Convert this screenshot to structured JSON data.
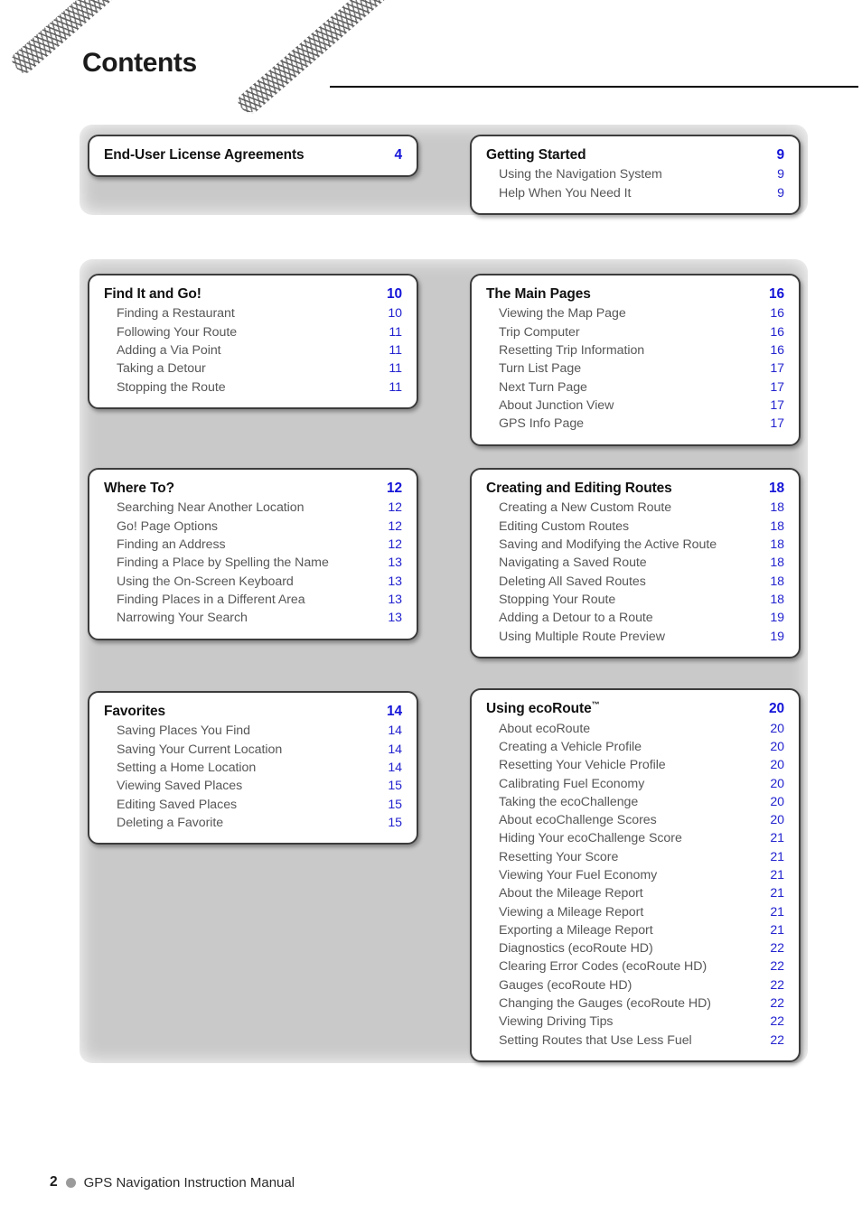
{
  "header": {
    "title": "Contents",
    "decor_icon": "braided-cable"
  },
  "sections": [
    {
      "id": "eula",
      "column": "left",
      "title": "End-User License Agreements",
      "page": "4",
      "items": []
    },
    {
      "id": "getting-started",
      "column": "right",
      "title": "Getting Started",
      "page": "9",
      "items": [
        {
          "title": "Using the Navigation System",
          "page": "9"
        },
        {
          "title": "Help When You Need It",
          "page": "9"
        }
      ]
    },
    {
      "id": "find-it-and-go",
      "column": "left",
      "title": "Find It and Go!",
      "page": "10",
      "items": [
        {
          "title": "Finding a Restaurant",
          "page": "10"
        },
        {
          "title": "Following Your Route",
          "page": "11"
        },
        {
          "title": "Adding a Via Point",
          "page": "11"
        },
        {
          "title": "Taking a Detour",
          "page": "11"
        },
        {
          "title": "Stopping the Route",
          "page": "11"
        }
      ]
    },
    {
      "id": "the-main-pages",
      "column": "right",
      "title": "The Main Pages",
      "page": "16",
      "items": [
        {
          "title": "Viewing the Map Page",
          "page": "16"
        },
        {
          "title": "Trip Computer",
          "page": "16"
        },
        {
          "title": "Resetting Trip Information",
          "page": "16"
        },
        {
          "title": "Turn List Page",
          "page": "17"
        },
        {
          "title": "Next Turn Page",
          "page": "17"
        },
        {
          "title": "About Junction View",
          "page": "17"
        },
        {
          "title": "GPS Info Page",
          "page": "17"
        }
      ]
    },
    {
      "id": "where-to",
      "column": "left",
      "title": "Where To?",
      "page": "12",
      "items": [
        {
          "title": "Searching Near Another Location",
          "page": "12"
        },
        {
          "title": "Go! Page Options",
          "page": "12"
        },
        {
          "title": "Finding an Address",
          "page": "12"
        },
        {
          "title": "Finding a Place by Spelling the Name",
          "page": "13"
        },
        {
          "title": "Using the On-Screen Keyboard",
          "page": "13"
        },
        {
          "title": "Finding Places in a Different Area",
          "page": "13"
        },
        {
          "title": "Narrowing Your Search",
          "page": "13"
        }
      ]
    },
    {
      "id": "creating-and-editing-routes",
      "column": "right",
      "title": "Creating and Editing Routes",
      "page": "18",
      "items": [
        {
          "title": "Creating a New Custom Route",
          "page": "18"
        },
        {
          "title": "Editing Custom Routes",
          "page": "18"
        },
        {
          "title": "Saving and Modifying the Active Route",
          "page": "18"
        },
        {
          "title": "Navigating a Saved Route",
          "page": "18"
        },
        {
          "title": "Deleting All Saved Routes",
          "page": "18"
        },
        {
          "title": "Stopping Your Route",
          "page": "18"
        },
        {
          "title": "Adding a Detour to a Route",
          "page": "19"
        },
        {
          "title": "Using Multiple Route Preview",
          "page": "19"
        }
      ]
    },
    {
      "id": "favorites",
      "column": "left",
      "title": "Favorites",
      "page": "14",
      "items": [
        {
          "title": "Saving Places You Find",
          "page": "14"
        },
        {
          "title": "Saving Your Current Location",
          "page": "14"
        },
        {
          "title": "Setting a Home Location",
          "page": "14"
        },
        {
          "title": "Viewing Saved Places",
          "page": "15"
        },
        {
          "title": "Editing Saved Places",
          "page": "15"
        },
        {
          "title": "Deleting a Favorite",
          "page": "15"
        }
      ]
    },
    {
      "id": "using-ecoroute",
      "column": "right",
      "title": "Using ecoRoute",
      "title_suffix": "™",
      "page": "20",
      "items": [
        {
          "title": "About ecoRoute",
          "page": "20"
        },
        {
          "title": "Creating a Vehicle Profile",
          "page": "20"
        },
        {
          "title": "Resetting Your Vehicle Profile",
          "page": "20"
        },
        {
          "title": "Calibrating Fuel Economy",
          "page": "20"
        },
        {
          "title": "Taking the ecoChallenge",
          "page": "20"
        },
        {
          "title": "About ecoChallenge Scores",
          "page": "20"
        },
        {
          "title": "Hiding Your ecoChallenge Score",
          "page": "21"
        },
        {
          "title": "Resetting Your Score",
          "page": "21"
        },
        {
          "title": "Viewing Your Fuel Economy",
          "page": "21"
        },
        {
          "title": "About the Mileage Report",
          "page": "21"
        },
        {
          "title": "Viewing a Mileage Report",
          "page": "21"
        },
        {
          "title": "Exporting a Mileage Report",
          "page": "21"
        },
        {
          "title": "Diagnostics (ecoRoute HD)",
          "page": "22"
        },
        {
          "title": "Clearing Error Codes (ecoRoute HD)",
          "page": "22"
        },
        {
          "title": "Gauges (ecoRoute HD)",
          "page": "22"
        },
        {
          "title": "Changing the Gauges (ecoRoute HD)",
          "page": "22"
        },
        {
          "title": "Viewing Driving Tips",
          "page": "22"
        },
        {
          "title": "Setting Routes that Use Less Fuel",
          "page": "22"
        }
      ]
    }
  ],
  "footer": {
    "page_number": "2",
    "bullet_icon": "circle-bullet",
    "text": "GPS Navigation Instruction Manual"
  },
  "colors": {
    "page_number_blue": "#1414d8",
    "sub_page_blue": "#2323cf",
    "heading_black": "#111111",
    "sub_text_gray": "#575757",
    "panel_gray": "#c9c9c9",
    "card_border": "#3c3c3c"
  }
}
